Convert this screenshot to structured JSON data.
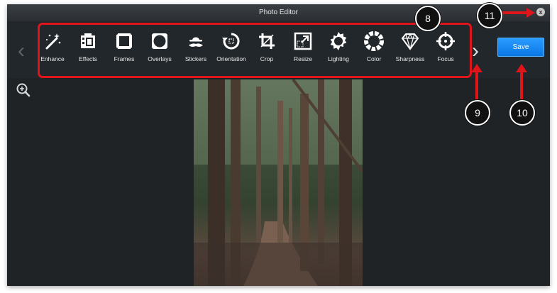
{
  "window": {
    "title": "Photo Editor"
  },
  "toolbar": {
    "close_label": "x",
    "save_label": "Save",
    "tools": [
      {
        "label": "Enhance",
        "icon": "magic-wand-icon"
      },
      {
        "label": "Effects",
        "icon": "film-icon"
      },
      {
        "label": "Frames",
        "icon": "frame-icon"
      },
      {
        "label": "Overlays",
        "icon": "overlay-icon"
      },
      {
        "label": "Stickers",
        "icon": "hat-mustache-icon"
      },
      {
        "label": "Orientation",
        "icon": "rotate-icon"
      },
      {
        "label": "Crop",
        "icon": "crop-icon"
      },
      {
        "label": "Resize",
        "icon": "resize-icon"
      },
      {
        "label": "Lighting",
        "icon": "sun-icon"
      },
      {
        "label": "Color",
        "icon": "color-wheel-icon"
      },
      {
        "label": "Sharpness",
        "icon": "diamond-icon"
      },
      {
        "label": "Focus",
        "icon": "focus-icon"
      }
    ]
  },
  "annotations": {
    "a8": "8",
    "a9": "9",
    "a10": "10",
    "a11": "11"
  },
  "colors": {
    "accent": "#0b78e6",
    "annotation": "#e0141b"
  }
}
